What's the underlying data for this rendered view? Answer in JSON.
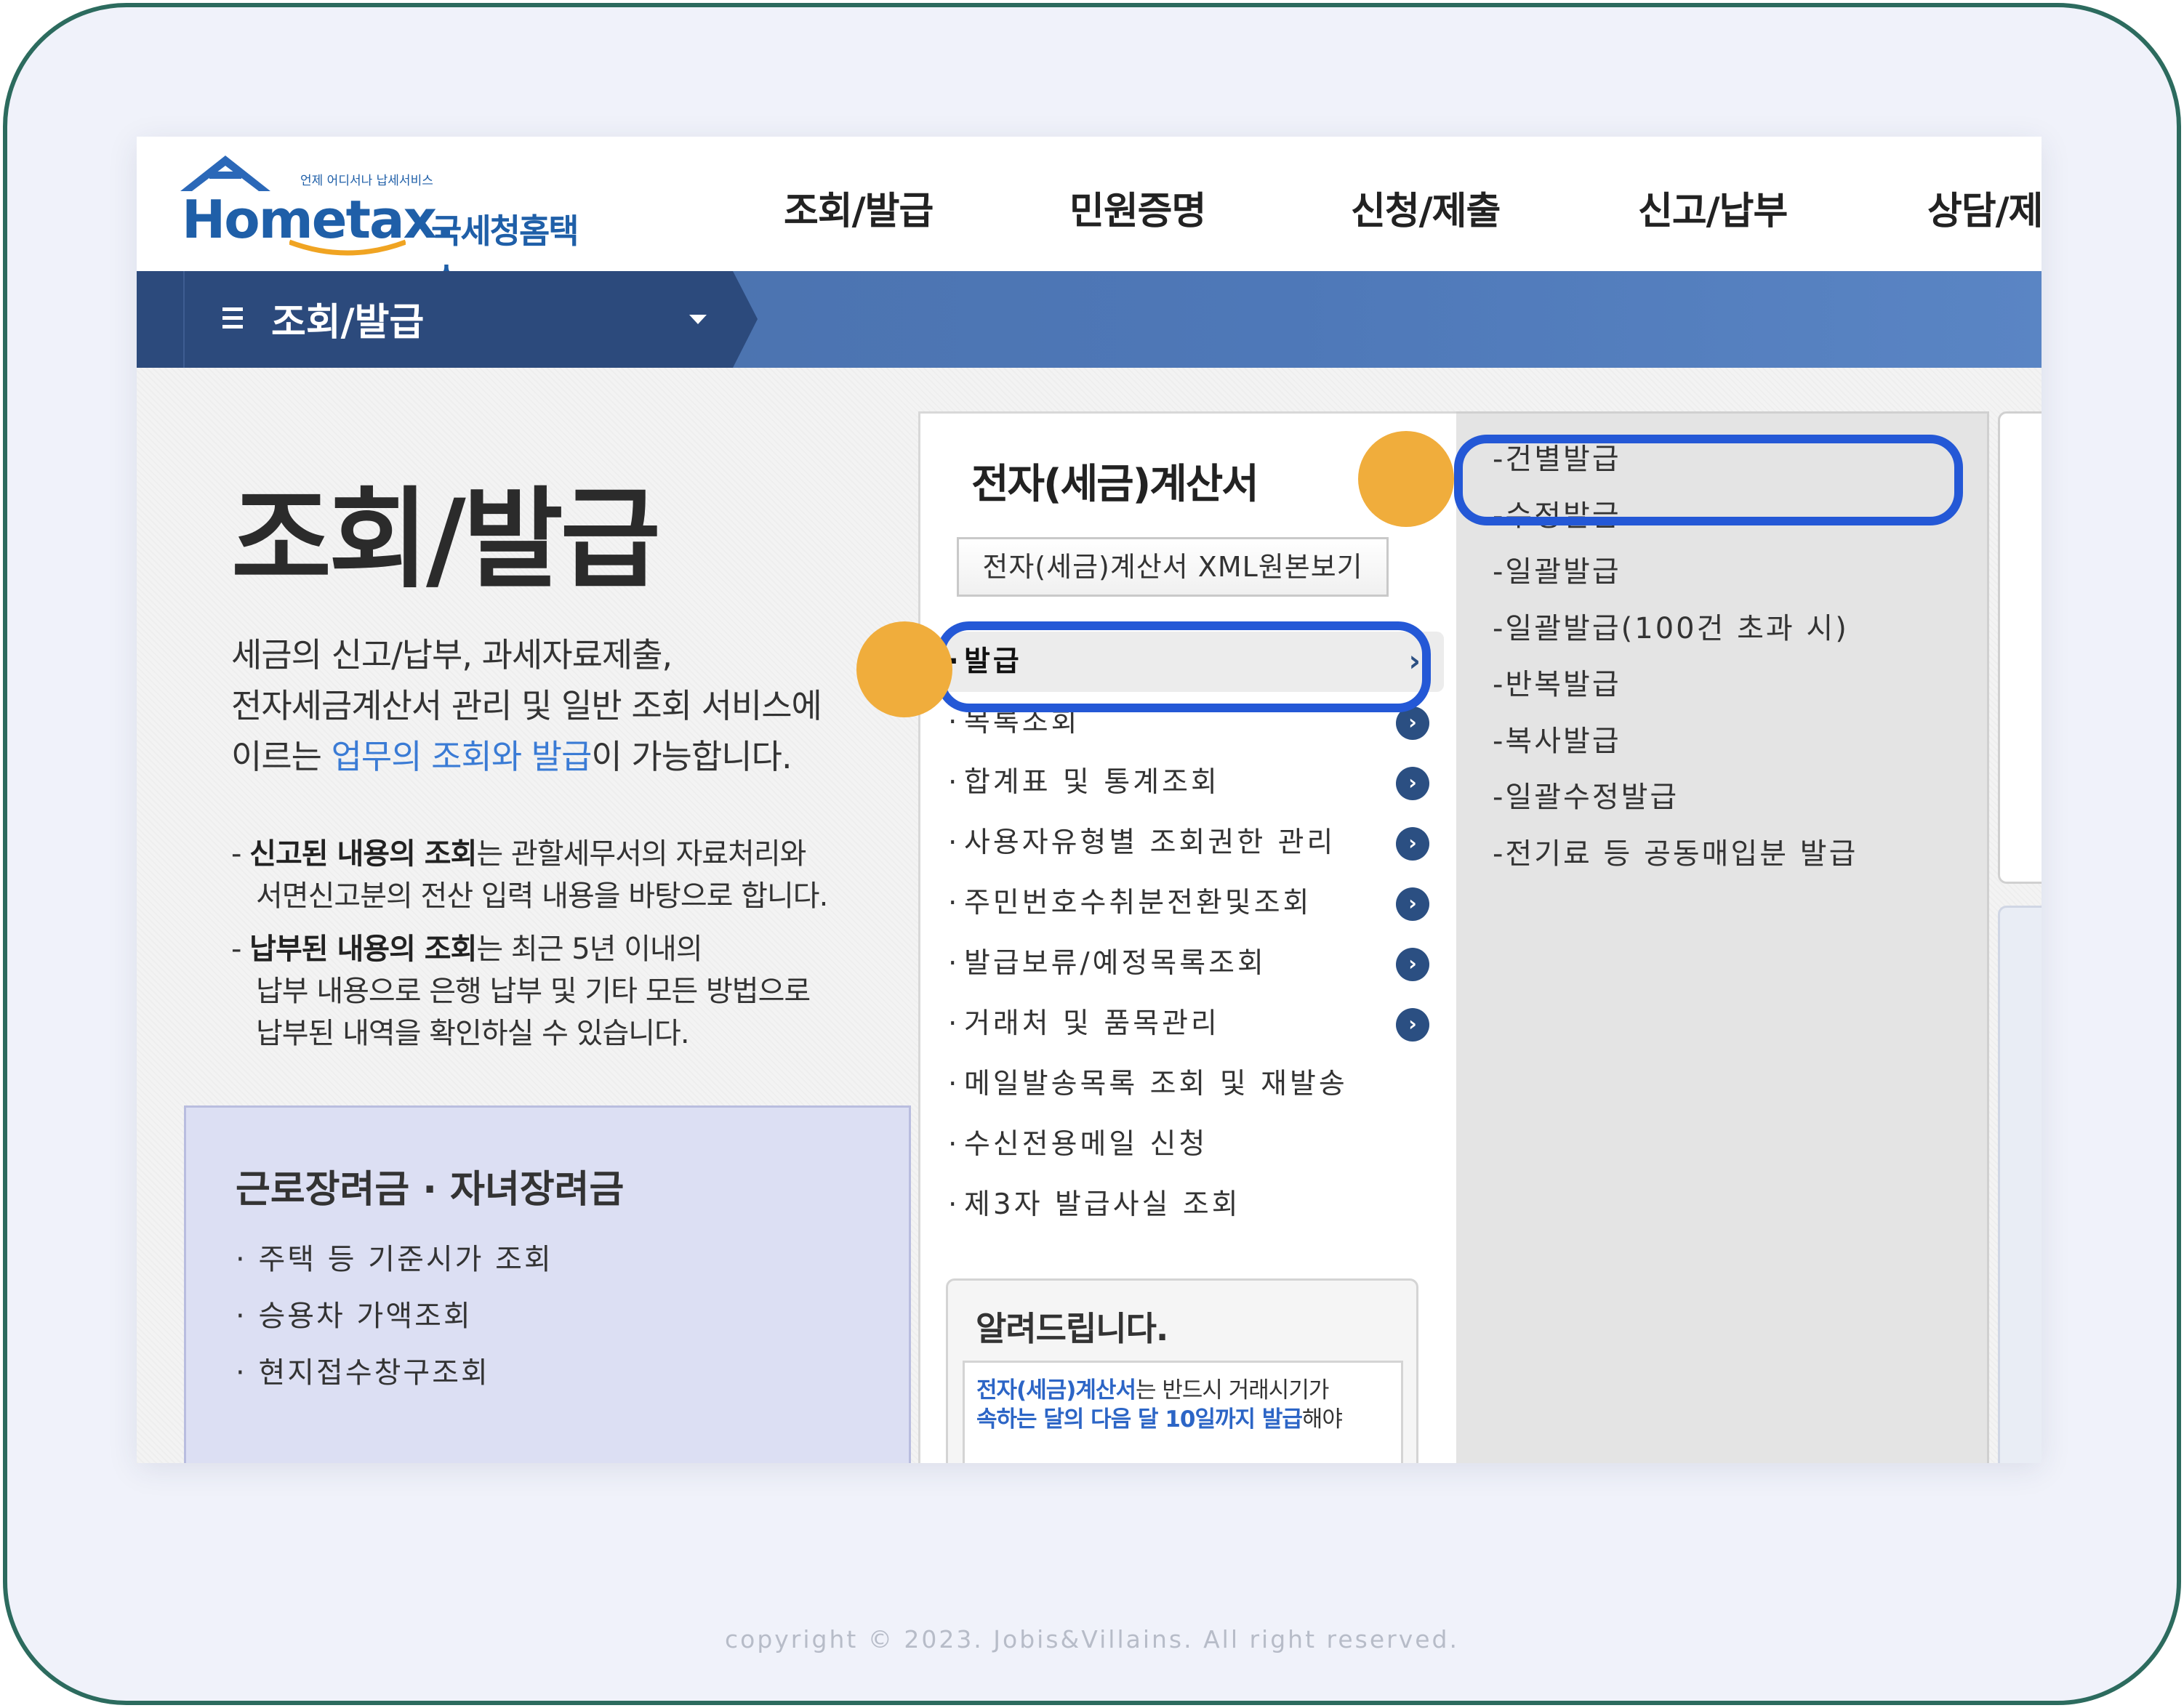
{
  "header": {
    "logo_text": "Hometax.",
    "logo_sub": "언제 어디서나 납세서비스",
    "logo_kr": "국세청홈택스",
    "nav": [
      "조회/발급",
      "민원증명",
      "신청/제출",
      "신고/납부",
      "상담/제"
    ]
  },
  "menubar": {
    "title": "조회/발급"
  },
  "left": {
    "title": "조회/발급",
    "intro_1": "세금의 신고/납부, 과세자료제출,",
    "intro_2": "전자세금계산서 관리 및 일반 조회 서비스에",
    "intro_3a": "이르는 ",
    "intro_3b": "업무의 조회와 발급",
    "intro_3c": "이 가능합니다.",
    "note1_bold": "신고된 내용의 조회",
    "note1_rest": "는 관할세무서의 자료처리와",
    "note1_line2": "서면신고분의 전산 입력 내용을 바탕으로 합니다.",
    "note2_bold": "납부된 내용의 조회",
    "note2_rest": "는 최근 5년 이내의",
    "note2_line2": "납부 내용으로 은행 납부 및 기타 모든 방법으로",
    "note2_line3": "납부된 내역을 확인하실 수 있습니다."
  },
  "panel": {
    "title": "근로장려금 · 자녀장려금",
    "items": [
      "주택 등 기준시가 조회",
      "승용차 가액조회",
      "현지접수창구조회"
    ]
  },
  "middle": {
    "title": "전자(세금)계산서",
    "xml_button": "전자(세금)계산서 XML원본보기",
    "items": [
      {
        "label": "발급",
        "active": true
      },
      {
        "label": "목록조회",
        "go": true
      },
      {
        "label": "합계표 및 통계조회",
        "go": true
      },
      {
        "label": "사용자유형별 조회권한 관리",
        "go": true
      },
      {
        "label": "주민번호수취분전환및조회",
        "go": true
      },
      {
        "label": "발급보류/예정목록조회",
        "go": true
      },
      {
        "label": "거래처 및 품목관리",
        "go": true
      },
      {
        "label": "메일발송목록 조회 및 재발송",
        "go": false
      },
      {
        "label": "수신전용메일 신청",
        "go": false
      },
      {
        "label": "제3자 발급사실 조회",
        "go": false
      }
    ],
    "notice_title": "알려드립니다.",
    "notice_blue1": "전자(세금)계산서",
    "notice_text1": "는 반드시 거래시기가",
    "notice_blue2": "속하는 달의 다음 달 10일까지 발급",
    "notice_text2": "해야"
  },
  "submenu": {
    "items": [
      "-건별발급",
      "-수정발급",
      "-일괄발급",
      "-일괄발급(100건 초과 시)",
      "-반복발급",
      "-복사발급",
      "-일괄수정발급",
      "-전기료 등 공동매입분 발급"
    ]
  },
  "footer": {
    "copyright": "copyright © 2023. Jobis&Villains. All right reserved."
  },
  "colors": {
    "frame": "#2c6b5e",
    "highlight_ring": "#2458d6",
    "highlight_dot": "#f0ad3c",
    "menubar": "#2c4a7c"
  }
}
